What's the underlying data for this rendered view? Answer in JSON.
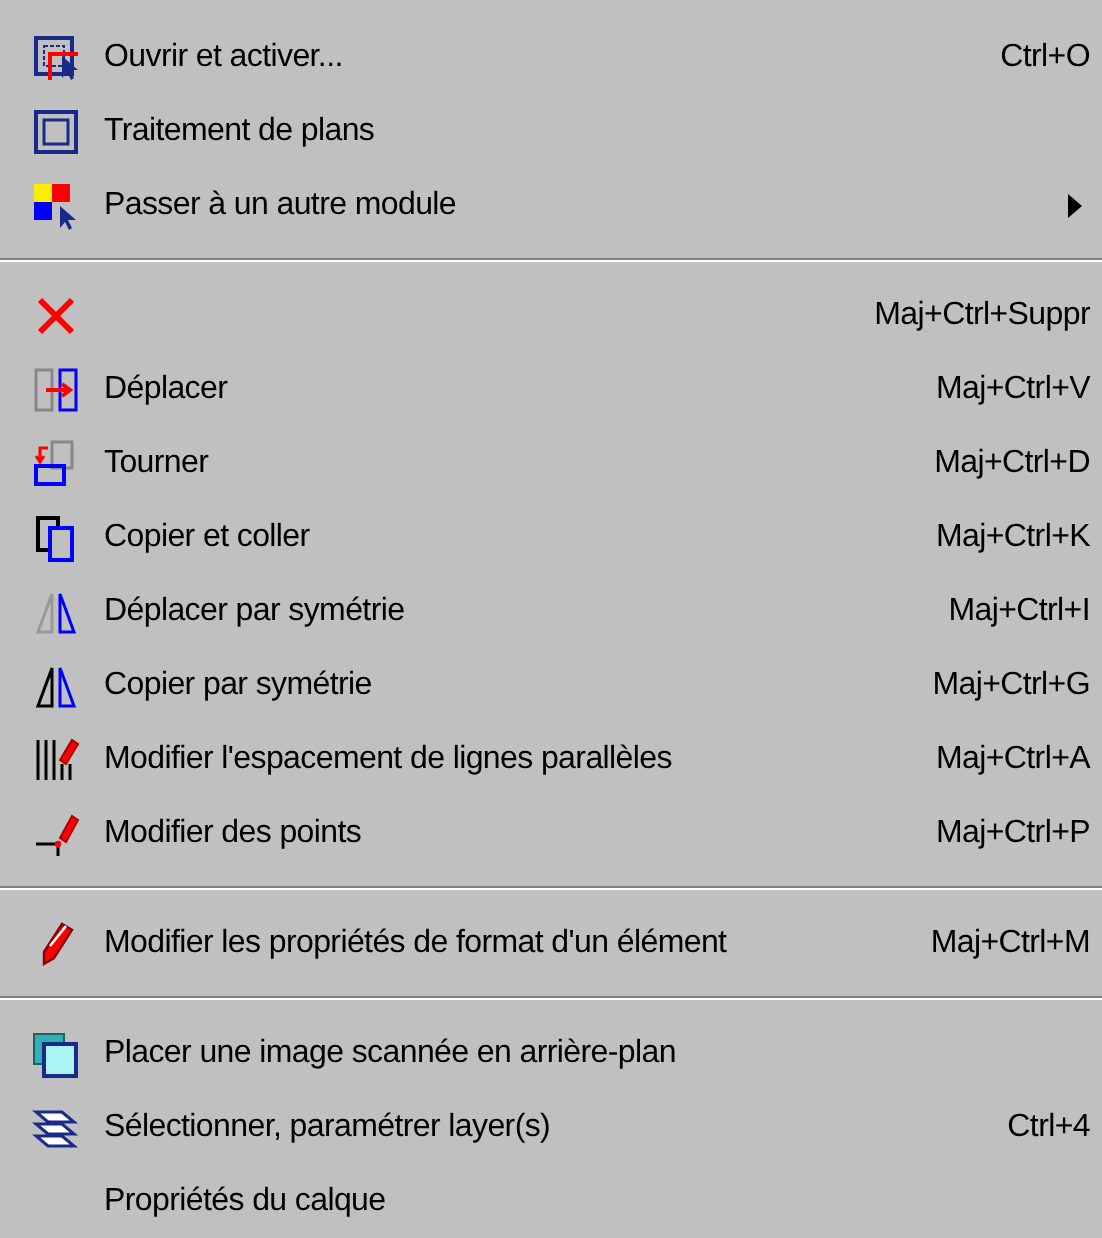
{
  "menu": {
    "items": [
      {
        "kind": "item",
        "label": "Ouvrir et activer...",
        "shortcut": "Ctrl+O",
        "submenu": false
      },
      {
        "kind": "item",
        "label": "Traitement de plans",
        "submenu": false
      },
      {
        "kind": "item",
        "label": "Passer à un autre module",
        "submenu": true
      },
      {
        "kind": "separator"
      },
      {
        "kind": "item",
        "shortcut": "Maj+Ctrl+Suppr",
        "submenu": false
      },
      {
        "kind": "item",
        "label": "Déplacer",
        "shortcut": "Maj+Ctrl+V",
        "submenu": false
      },
      {
        "kind": "item",
        "label": "Tourner",
        "shortcut": "Maj+Ctrl+D",
        "submenu": false
      },
      {
        "kind": "item",
        "label": "Copier et coller",
        "shortcut": "Maj+Ctrl+K",
        "submenu": false
      },
      {
        "kind": "item",
        "label": "Déplacer par symétrie",
        "shortcut": "Maj+Ctrl+I",
        "submenu": false
      },
      {
        "kind": "item",
        "label": "Copier par symétrie",
        "shortcut": "Maj+Ctrl+G",
        "submenu": false
      },
      {
        "kind": "item",
        "label": "Modifier l'espacement de lignes parallèles",
        "shortcut": "Maj+Ctrl+A",
        "submenu": false
      },
      {
        "kind": "item",
        "label": "Modifier des points",
        "shortcut": "Maj+Ctrl+P",
        "submenu": false
      },
      {
        "kind": "separator"
      },
      {
        "kind": "item",
        "label": "Modifier les propriétés de format d'un élément",
        "shortcut": "Maj+Ctrl+M",
        "submenu": false
      },
      {
        "kind": "separator"
      },
      {
        "kind": "item",
        "label": "Placer une image scannée en arrière-plan",
        "submenu": false
      },
      {
        "kind": "item",
        "label": "Sélectionner, paramétrer layer(s)",
        "shortcut": "Ctrl+4",
        "submenu": false
      },
      {
        "kind": "item",
        "label": "Propriétés du calque",
        "submenu": false
      }
    ]
  }
}
